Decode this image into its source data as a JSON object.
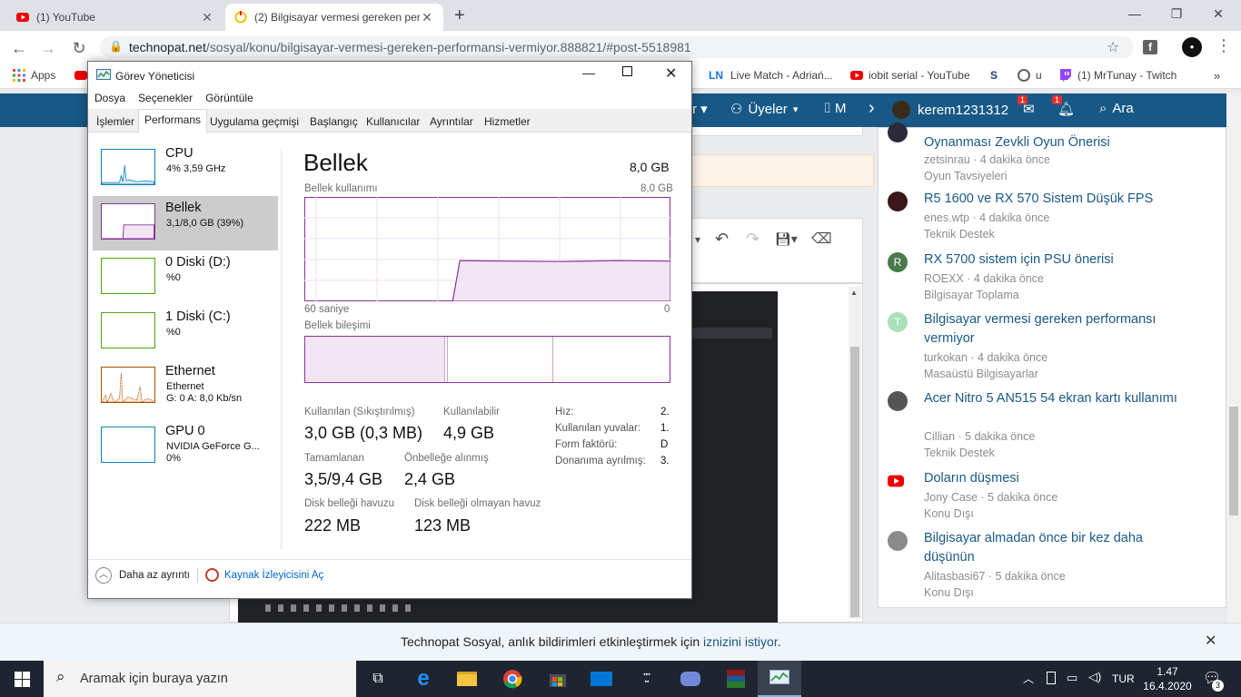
{
  "browser": {
    "tabs": [
      {
        "title": "(1) YouTube"
      },
      {
        "title": "(2) Bilgisayar vermesi gereken per"
      }
    ],
    "url_host": "technopat.net",
    "url_path": "/sosyal/konu/bilgisayar-vermesi-gereken-performansi-vermiyor.888821/#post-5518981",
    "bookmarks": [
      {
        "label": "Apps"
      },
      {
        "label": "Live Match - Adriań..."
      },
      {
        "label": "iobit serial - YouTube"
      },
      {
        "label": "u"
      },
      {
        "label": "(1) MrTunay - Twitch"
      }
    ],
    "ln_badge": "LN",
    "s_badge": "S"
  },
  "site": {
    "nav": {
      "members": "Üyeler",
      "photos": "M",
      "username": "kerem1231312",
      "search": "Ara",
      "msg_badge": "1",
      "alert_badge": "1"
    },
    "threads": [
      {
        "title": "Oynanması Zevkli Oyun Önerisi",
        "meta": "zetsinrau · 4 dakika önce",
        "category": "Oyun Tavsiyeleri",
        "avatar_letter": ""
      },
      {
        "title": "R5 1600 ve RX 570 Sistem Düşük FPS",
        "meta": "enes.wtp · 4 dakika önce",
        "category": "Teknik Destek",
        "avatar_letter": ""
      },
      {
        "title": "RX 5700 sistem için PSU önerisi",
        "meta": "ROEXX · 4 dakika önce",
        "category": "Bilgisayar Toplama",
        "avatar_letter": "R"
      },
      {
        "title": "Bilgisayar vermesi gereken performansı vermiyor",
        "meta": "turkokan · 4 dakika önce",
        "category": "Masaüstü Bilgisayarlar",
        "avatar_letter": "T"
      },
      {
        "title": "Acer Nitro 5 AN515 54 ekran kartı kullanımı",
        "meta": "Cillian · 5 dakika önce",
        "category": "Teknik Destek",
        "avatar_letter": ""
      },
      {
        "title": "Doların düşmesi",
        "meta": "Jony Case · 5 dakika önce",
        "category": "Konu Dışı",
        "avatar_letter": ""
      },
      {
        "title": "Bilgisayar almadan önce bir kez daha düşünün",
        "meta": "Alitasbasi67 · 5 dakika önce",
        "category": "Konu Dışı",
        "avatar_letter": ""
      }
    ]
  },
  "task_manager": {
    "title": "Görev Yöneticisi",
    "menu": [
      "Dosya",
      "Seçenekler",
      "Görüntüle"
    ],
    "tabs": [
      "İşlemler",
      "Performans",
      "Uygulama geçmişi",
      "Başlangıç",
      "Kullanıcılar",
      "Ayrıntılar",
      "Hizmetler"
    ],
    "selected_tab": "Performans",
    "perf_items": [
      {
        "name": "CPU",
        "line1": "4%  3,59 GHz",
        "line2": ""
      },
      {
        "name": "Bellek",
        "line1": "3,1/8,0 GB (39%)",
        "line2": ""
      },
      {
        "name": "0 Diski (D:)",
        "line1": "%0",
        "line2": ""
      },
      {
        "name": "1 Diski (C:)",
        "line1": "%0",
        "line2": ""
      },
      {
        "name": "Ethernet",
        "line1": "Ethernet",
        "line2": "G: 0 A: 8,0 Kb/sn"
      },
      {
        "name": "GPU 0",
        "line1": "NVIDIA GeForce G...",
        "line2": "0%"
      }
    ],
    "detail": {
      "title": "Bellek",
      "total": "8,0 GB",
      "usage_label": "Bellek kullanımı",
      "usage_max": "8,0 GB",
      "time_left": "60 saniye",
      "time_right": "0",
      "composition_label": "Bellek bileşimi",
      "stats": {
        "in_use_label": "Kullanılan (Sıkıştırılmış)",
        "in_use": "3,0 GB (0,3 MB)",
        "available_label": "Kullanılabilir",
        "available": "4,9 GB",
        "committed_label": "Tamamlanan",
        "committed": "3,5/9,4 GB",
        "cached_label": "Önbelleğe alınmış",
        "cached": "2,4 GB",
        "paged_label": "Disk belleği havuzu",
        "paged": "222 MB",
        "nonpaged_label": "Disk belleği olmayan havuz",
        "nonpaged": "123 MB"
      },
      "side": [
        {
          "label": "Hız:",
          "value": "2."
        },
        {
          "label": "Kullanılan yuvalar:",
          "value": "1."
        },
        {
          "label": "Form faktörü:",
          "value": "D"
        },
        {
          "label": "Donanıma ayrılmış:",
          "value": "3."
        }
      ],
      "memory_usage_fraction": 0.39
    },
    "footer": {
      "less_details": "Daha az ayrıntı",
      "resource_monitor": "Kaynak İzleyicisini Aç"
    }
  },
  "notification": {
    "text": "Technopat Sosyal, anlık bildirimleri etkinleştirmek için",
    "link": "iznizini istiyor",
    "period": "."
  },
  "taskbar": {
    "search_placeholder": "Aramak için buraya yazın",
    "lang": "TUR",
    "time": "1.47",
    "date": "16.4.2020",
    "notif_count": "3"
  },
  "colors": {
    "nav_blue": "#185886",
    "memory_purple": "#8b2f9e",
    "cpu_blue": "#117dbb",
    "disk_green": "#4da60c",
    "eth_orange": "#a74f01",
    "taskbar": "#1e2430"
  }
}
